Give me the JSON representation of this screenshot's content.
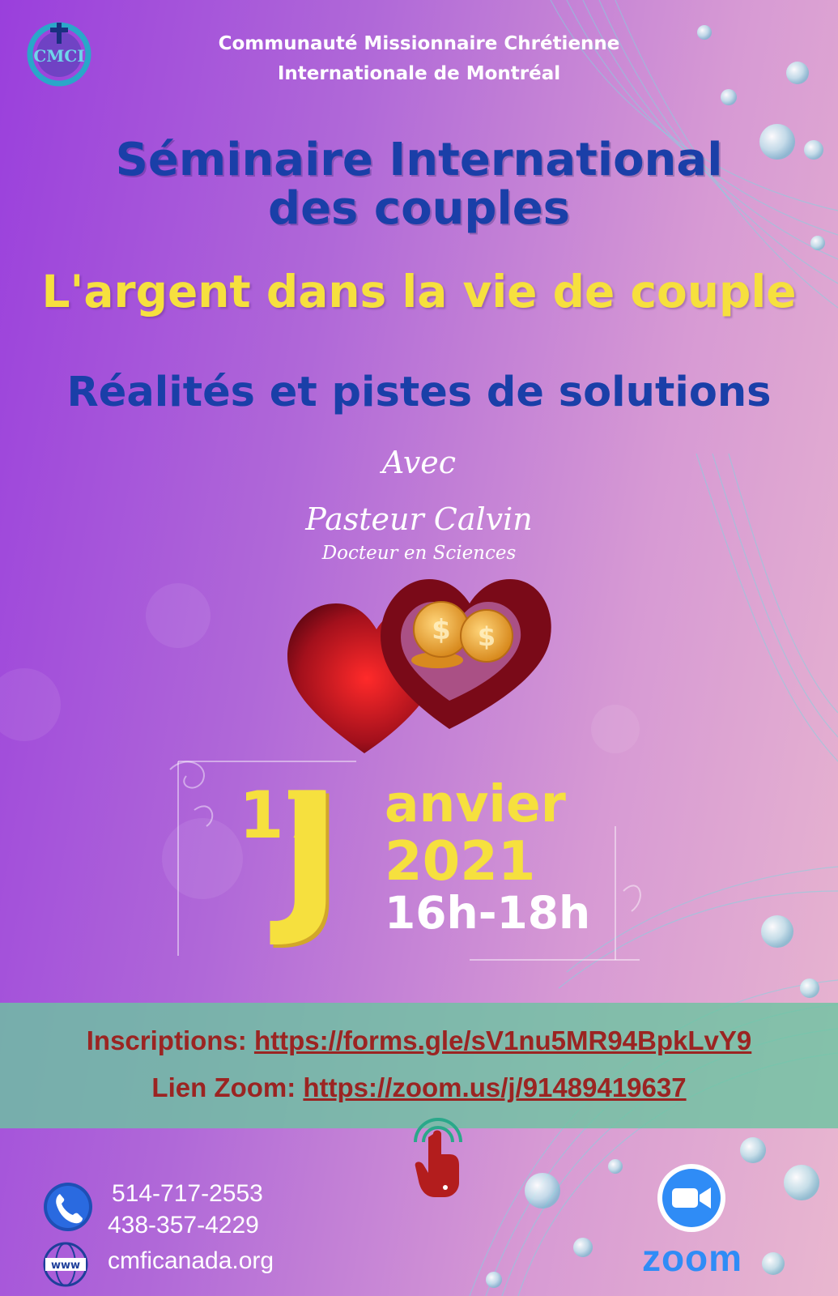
{
  "organization": {
    "line1": "Communauté Missionnaire Chrétienne",
    "line2": "Internationale de Montréal",
    "logo_text": "CMCI"
  },
  "title": {
    "line1": "Séminaire International",
    "line2": "des couples"
  },
  "theme": "L'argent dans la vie de couple",
  "subtheme": "Réalités et pistes de solutions",
  "speaker": {
    "intro": "Avec",
    "name": "Pasteur Calvin",
    "credential": "Docteur en Sciences"
  },
  "date": {
    "day": "17",
    "month_initial": "J",
    "month_rest": "anvier",
    "year": "2021",
    "time": "16h-18h"
  },
  "links": {
    "registration_label": "Inscriptions: ",
    "registration_url": "https://forms.gle/sV1nu5MR94BpkLvY9",
    "zoom_label": "Lien Zoom: ",
    "zoom_url": "https://zoom.us/j/91489419637"
  },
  "contact": {
    "phone1": "514-717-2553",
    "phone2": "438-357-4229",
    "website": "cmficanada.org",
    "www_icon_text": "www"
  },
  "zoom_brand": "zoom",
  "colors": {
    "title_blue": "#1a3fa8",
    "accent_yellow": "#f6e03e",
    "link_red": "#9b2422",
    "band_teal": "#6cc4a0",
    "zoom_blue": "#2f8cf6"
  },
  "icons": [
    "cmci-logo",
    "hearts-with-coins-icon",
    "tap-hand-icon",
    "phone-icon",
    "globe-www-icon",
    "zoom-camera-icon"
  ]
}
